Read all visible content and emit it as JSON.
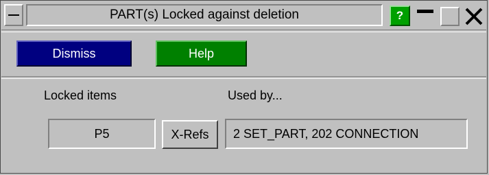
{
  "window": {
    "title": "PART(s) Locked against deletion",
    "help_glyph": "?",
    "controls": [
      "sysmenu-icon",
      "help-icon",
      "minimize-icon",
      "maximize-icon",
      "close-icon"
    ]
  },
  "buttons": {
    "dismiss_label": "Dismiss",
    "help_label": "Help",
    "xrefs_label": "X-Refs"
  },
  "table": {
    "headers": {
      "locked_items": "Locked items",
      "used_by": "Used by..."
    },
    "rows": [
      {
        "locked_item": "P5",
        "used_by": "2 SET_PART, 202 CONNECTION"
      }
    ]
  },
  "colors": {
    "dismiss_bg": "#000080",
    "help_bg": "#008000",
    "panel_bg": "#c0c0c0"
  }
}
